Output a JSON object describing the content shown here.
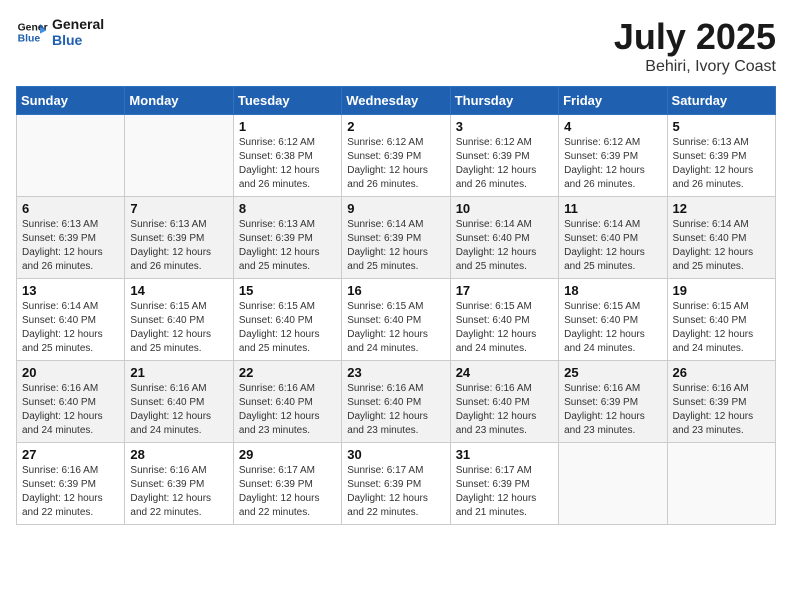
{
  "header": {
    "logo_line1": "General",
    "logo_line2": "Blue",
    "month": "July 2025",
    "location": "Behiri, Ivory Coast"
  },
  "weekdays": [
    "Sunday",
    "Monday",
    "Tuesday",
    "Wednesday",
    "Thursday",
    "Friday",
    "Saturday"
  ],
  "weeks": [
    [
      {
        "day": "",
        "info": ""
      },
      {
        "day": "",
        "info": ""
      },
      {
        "day": "1",
        "info": "Sunrise: 6:12 AM\nSunset: 6:38 PM\nDaylight: 12 hours and 26 minutes."
      },
      {
        "day": "2",
        "info": "Sunrise: 6:12 AM\nSunset: 6:39 PM\nDaylight: 12 hours and 26 minutes."
      },
      {
        "day": "3",
        "info": "Sunrise: 6:12 AM\nSunset: 6:39 PM\nDaylight: 12 hours and 26 minutes."
      },
      {
        "day": "4",
        "info": "Sunrise: 6:12 AM\nSunset: 6:39 PM\nDaylight: 12 hours and 26 minutes."
      },
      {
        "day": "5",
        "info": "Sunrise: 6:13 AM\nSunset: 6:39 PM\nDaylight: 12 hours and 26 minutes."
      }
    ],
    [
      {
        "day": "6",
        "info": "Sunrise: 6:13 AM\nSunset: 6:39 PM\nDaylight: 12 hours and 26 minutes."
      },
      {
        "day": "7",
        "info": "Sunrise: 6:13 AM\nSunset: 6:39 PM\nDaylight: 12 hours and 26 minutes."
      },
      {
        "day": "8",
        "info": "Sunrise: 6:13 AM\nSunset: 6:39 PM\nDaylight: 12 hours and 25 minutes."
      },
      {
        "day": "9",
        "info": "Sunrise: 6:14 AM\nSunset: 6:39 PM\nDaylight: 12 hours and 25 minutes."
      },
      {
        "day": "10",
        "info": "Sunrise: 6:14 AM\nSunset: 6:40 PM\nDaylight: 12 hours and 25 minutes."
      },
      {
        "day": "11",
        "info": "Sunrise: 6:14 AM\nSunset: 6:40 PM\nDaylight: 12 hours and 25 minutes."
      },
      {
        "day": "12",
        "info": "Sunrise: 6:14 AM\nSunset: 6:40 PM\nDaylight: 12 hours and 25 minutes."
      }
    ],
    [
      {
        "day": "13",
        "info": "Sunrise: 6:14 AM\nSunset: 6:40 PM\nDaylight: 12 hours and 25 minutes."
      },
      {
        "day": "14",
        "info": "Sunrise: 6:15 AM\nSunset: 6:40 PM\nDaylight: 12 hours and 25 minutes."
      },
      {
        "day": "15",
        "info": "Sunrise: 6:15 AM\nSunset: 6:40 PM\nDaylight: 12 hours and 25 minutes."
      },
      {
        "day": "16",
        "info": "Sunrise: 6:15 AM\nSunset: 6:40 PM\nDaylight: 12 hours and 24 minutes."
      },
      {
        "day": "17",
        "info": "Sunrise: 6:15 AM\nSunset: 6:40 PM\nDaylight: 12 hours and 24 minutes."
      },
      {
        "day": "18",
        "info": "Sunrise: 6:15 AM\nSunset: 6:40 PM\nDaylight: 12 hours and 24 minutes."
      },
      {
        "day": "19",
        "info": "Sunrise: 6:15 AM\nSunset: 6:40 PM\nDaylight: 12 hours and 24 minutes."
      }
    ],
    [
      {
        "day": "20",
        "info": "Sunrise: 6:16 AM\nSunset: 6:40 PM\nDaylight: 12 hours and 24 minutes."
      },
      {
        "day": "21",
        "info": "Sunrise: 6:16 AM\nSunset: 6:40 PM\nDaylight: 12 hours and 24 minutes."
      },
      {
        "day": "22",
        "info": "Sunrise: 6:16 AM\nSunset: 6:40 PM\nDaylight: 12 hours and 23 minutes."
      },
      {
        "day": "23",
        "info": "Sunrise: 6:16 AM\nSunset: 6:40 PM\nDaylight: 12 hours and 23 minutes."
      },
      {
        "day": "24",
        "info": "Sunrise: 6:16 AM\nSunset: 6:40 PM\nDaylight: 12 hours and 23 minutes."
      },
      {
        "day": "25",
        "info": "Sunrise: 6:16 AM\nSunset: 6:39 PM\nDaylight: 12 hours and 23 minutes."
      },
      {
        "day": "26",
        "info": "Sunrise: 6:16 AM\nSunset: 6:39 PM\nDaylight: 12 hours and 23 minutes."
      }
    ],
    [
      {
        "day": "27",
        "info": "Sunrise: 6:16 AM\nSunset: 6:39 PM\nDaylight: 12 hours and 22 minutes."
      },
      {
        "day": "28",
        "info": "Sunrise: 6:16 AM\nSunset: 6:39 PM\nDaylight: 12 hours and 22 minutes."
      },
      {
        "day": "29",
        "info": "Sunrise: 6:17 AM\nSunset: 6:39 PM\nDaylight: 12 hours and 22 minutes."
      },
      {
        "day": "30",
        "info": "Sunrise: 6:17 AM\nSunset: 6:39 PM\nDaylight: 12 hours and 22 minutes."
      },
      {
        "day": "31",
        "info": "Sunrise: 6:17 AM\nSunset: 6:39 PM\nDaylight: 12 hours and 21 minutes."
      },
      {
        "day": "",
        "info": ""
      },
      {
        "day": "",
        "info": ""
      }
    ]
  ]
}
